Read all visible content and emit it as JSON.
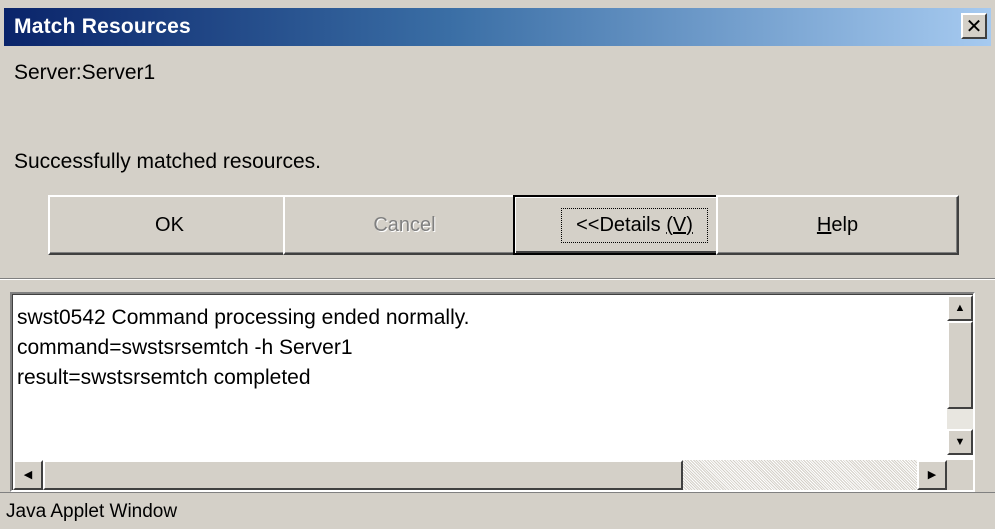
{
  "window": {
    "title": "Match Resources",
    "close_label": "✕"
  },
  "info": {
    "server": "Server:Server1",
    "status": "Successfully matched resources."
  },
  "buttons": {
    "ok": "OK",
    "cancel": "Cancel",
    "details_prefix": "<<Details ",
    "details_mnemonic": "(V)",
    "help_mnemonic": "H",
    "help_rest": "elp"
  },
  "details": {
    "lines": [
      "swst0542 Command processing ended normally.",
      "command=swstsrsemtch -h Server1",
      "result=swstsrsemtch completed"
    ]
  },
  "scroll": {
    "up_arrow": "▲",
    "down_arrow": "▼",
    "left_arrow": "◀",
    "right_arrow": "▶"
  },
  "footer": {
    "text": "Java Applet Window"
  }
}
